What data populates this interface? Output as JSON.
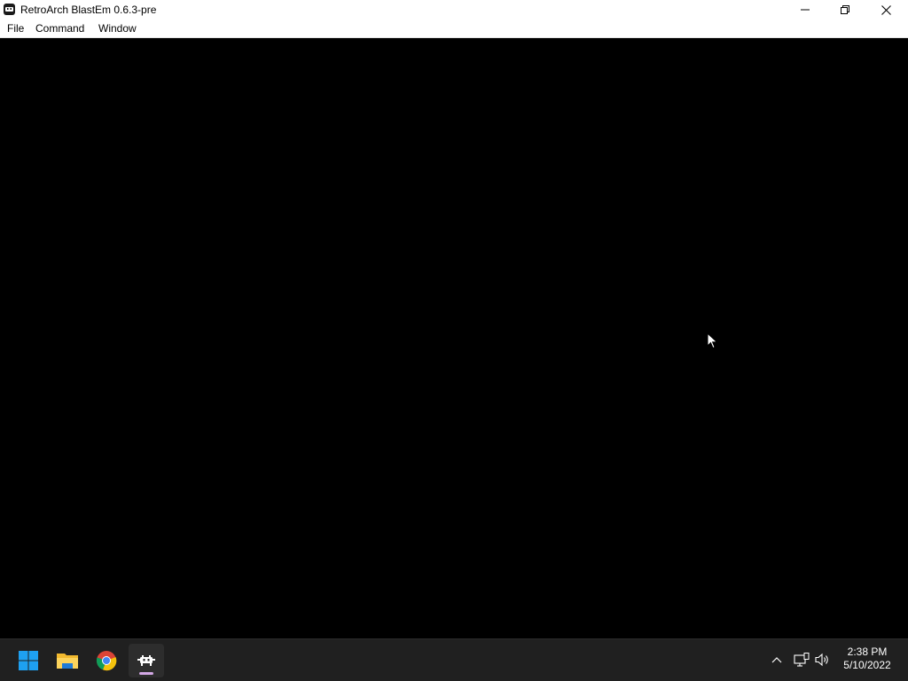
{
  "window": {
    "title": "RetroArch BlastEm 0.6.3-pre"
  },
  "menu": {
    "items": [
      {
        "label": "File"
      },
      {
        "label": "Command"
      },
      {
        "label": "Window"
      }
    ]
  },
  "taskbar": {
    "apps": [
      {
        "icon": "windows-start-icon"
      },
      {
        "icon": "file-explorer-icon"
      },
      {
        "icon": "chrome-icon"
      },
      {
        "icon": "retroarch-icon",
        "active": true
      }
    ],
    "accent_color": "#d4a8e6"
  },
  "tray": {
    "icons": [
      "chevron-up-icon",
      "network-icon",
      "volume-icon"
    ],
    "time": "2:38 PM",
    "date": "5/10/2022"
  }
}
